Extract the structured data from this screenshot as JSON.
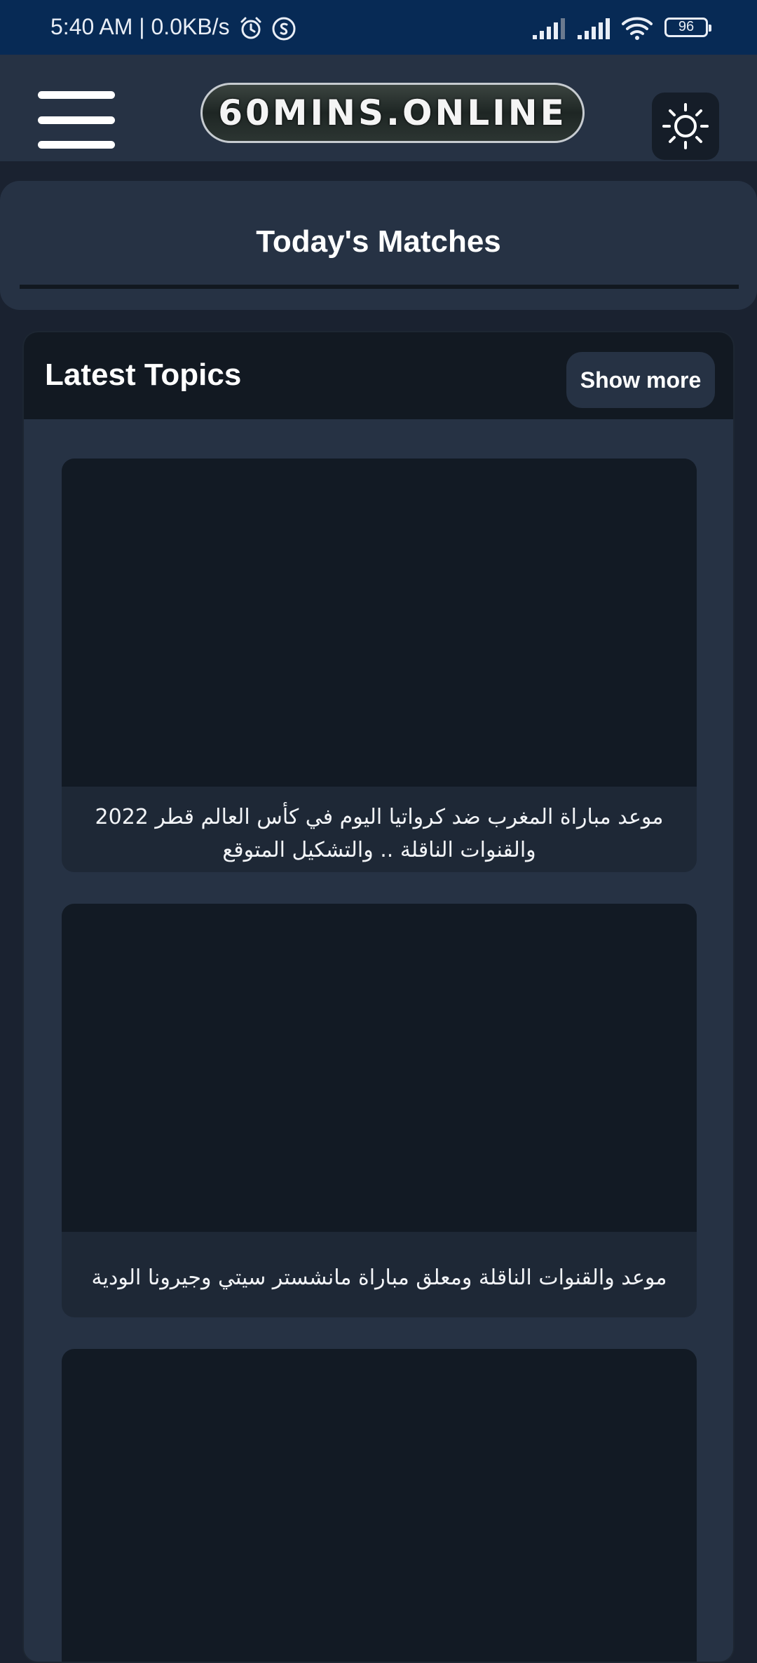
{
  "status_bar": {
    "time_speed": "5:40 AM | 0.0KB/s",
    "battery": "96"
  },
  "header": {
    "logo_text": "60MINS.ONLINE"
  },
  "matches": {
    "title": "Today's Matches"
  },
  "topics": {
    "title": "Latest Topics",
    "show_more_label": "Show more",
    "articles": [
      {
        "title": "موعد مباراة المغرب ضد كرواتيا اليوم في كأس العالم قطر 2022 والقنوات الناقلة .. والتشكيل المتوقع"
      },
      {
        "title": "موعد والقنوات الناقلة ومعلق مباراة مانشستر سيتي وجيرونا الودية"
      },
      {
        "title": ""
      }
    ]
  },
  "colors": {
    "status_bar": "#072a55",
    "header": "#263244",
    "background": "#1a2230",
    "topics_header": "#121922",
    "thumbnail": "#121a24"
  }
}
